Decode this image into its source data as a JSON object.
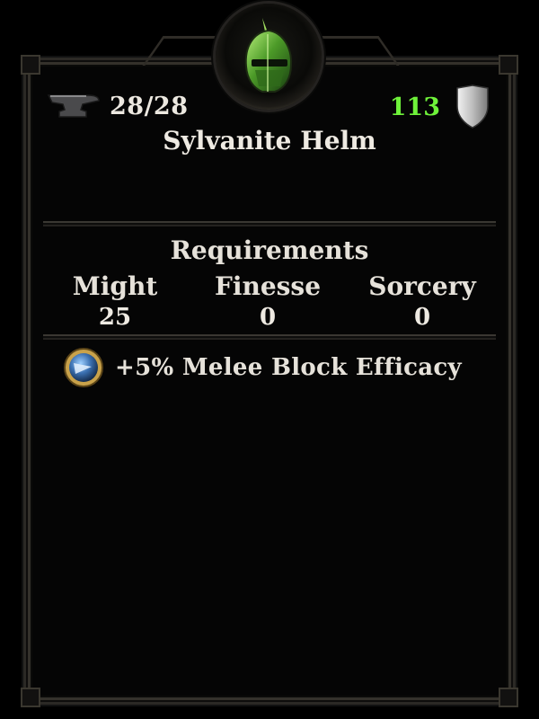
{
  "item": {
    "name": "Sylvanite Helm",
    "icon": "green-helmet-icon"
  },
  "durability": {
    "icon": "anvil-icon",
    "value": "28/28"
  },
  "armor": {
    "icon": "shield-icon",
    "value": "113",
    "color": "#6ff23a"
  },
  "requirements": {
    "title": "Requirements",
    "stats": [
      {
        "name": "Might",
        "value": "25"
      },
      {
        "name": "Finesse",
        "value": "0"
      },
      {
        "name": "Sorcery",
        "value": "0"
      }
    ]
  },
  "bonuses": [
    {
      "icon": "block-efficacy-orb-icon",
      "text": "+5% Melee Block Efficacy"
    }
  ]
}
